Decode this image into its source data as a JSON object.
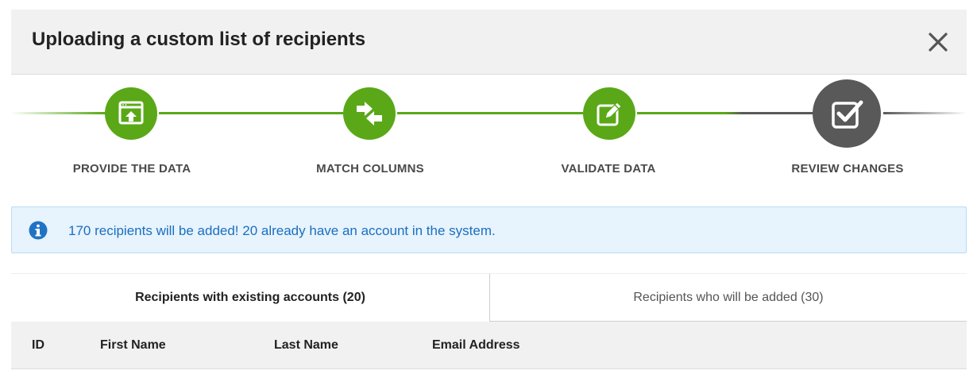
{
  "dialog": {
    "title": "Uploading a custom list of recipients",
    "close_icon": "close-icon"
  },
  "steps": [
    {
      "label": "PROVIDE THE DATA",
      "icon": "upload-window-icon",
      "state": "complete"
    },
    {
      "label": "MATCH COLUMNS",
      "icon": "swap-arrows-icon",
      "state": "complete"
    },
    {
      "label": "VALIDATE DATA",
      "icon": "edit-pencil-icon",
      "state": "complete"
    },
    {
      "label": "REVIEW CHANGES",
      "icon": "checkbox-icon",
      "state": "active"
    }
  ],
  "alert": {
    "icon": "info-icon",
    "text": "170 recipients will be added! 20 already have an account in the system."
  },
  "tabs": [
    {
      "label": "Recipients with existing accounts (20)",
      "active": true
    },
    {
      "label": "Recipients who will be added (30)",
      "active": false
    }
  ],
  "table": {
    "columns": [
      "ID",
      "First Name",
      "Last Name",
      "Email Address"
    ]
  },
  "colors": {
    "step_complete": "#5aa818",
    "step_active": "#595959",
    "alert_text": "#1a6fbf",
    "alert_icon": "#1f73c4"
  }
}
